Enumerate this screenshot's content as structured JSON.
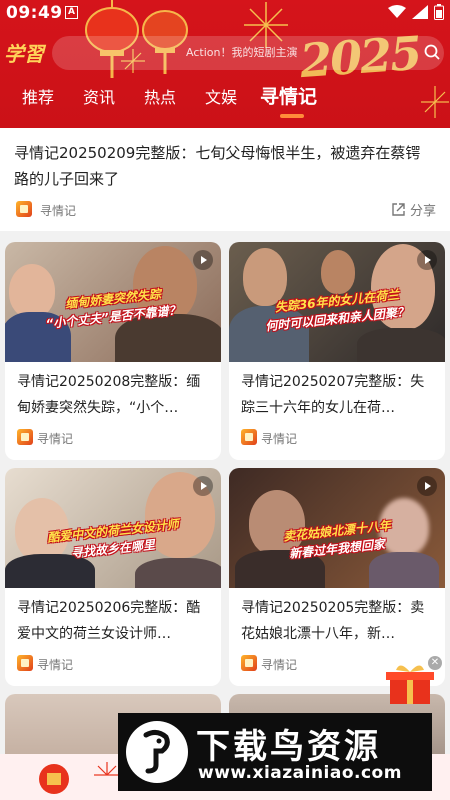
{
  "status_bar": {
    "time": "09:49",
    "notification": "A"
  },
  "header": {
    "logo_text": "学習",
    "search_placeholder": "Action！我的短剧主演",
    "decoration_year": "2025",
    "tabs": [
      {
        "label": "推荐",
        "active": false
      },
      {
        "label": "资讯",
        "active": false
      },
      {
        "label": "热点",
        "active": false
      },
      {
        "label": "文娱",
        "active": false
      },
      {
        "label": "寻情记",
        "active": true
      }
    ],
    "accent_color": "#d5141b",
    "tab_indicator_color": "#ff8c3a"
  },
  "feed": {
    "top_item": {
      "title": "寻情记20250209完整版：七旬父母悔恨半生，被遗弃在蔡锷路的儿子回来了",
      "source": "寻情记",
      "share_label": "分享"
    },
    "cards": [
      {
        "title": "寻情记20250208完整版：缅甸娇妻突然失踪，“小个…",
        "source": "寻情记",
        "caption_line1": "缅甸娇妻突然失踪",
        "caption_line2": "“小个丈夫”是否不靠谱？"
      },
      {
        "title": "寻情记20250207完整版：失踪三十六年的女儿在荷…",
        "source": "寻情记",
        "caption_line1": "失踪36年的女儿在荷兰",
        "caption_line2": "何时可以回来和亲人团聚？"
      },
      {
        "title": "寻情记20250206完整版：酷爱中文的荷兰女设计师…",
        "source": "寻情记",
        "caption_line1": "酷爱中文的荷兰女设计师",
        "caption_line2": "寻找故乡在哪里"
      },
      {
        "title": "寻情记20250205完整版：卖花姑娘北漂十八年，新…",
        "source": "寻情记",
        "caption_line1": "卖花姑娘北漂十八年",
        "caption_line2": "新春过年我想回家"
      }
    ]
  },
  "watermark": {
    "title": "下载鸟资源",
    "url": "www.xiazainiao.com"
  }
}
